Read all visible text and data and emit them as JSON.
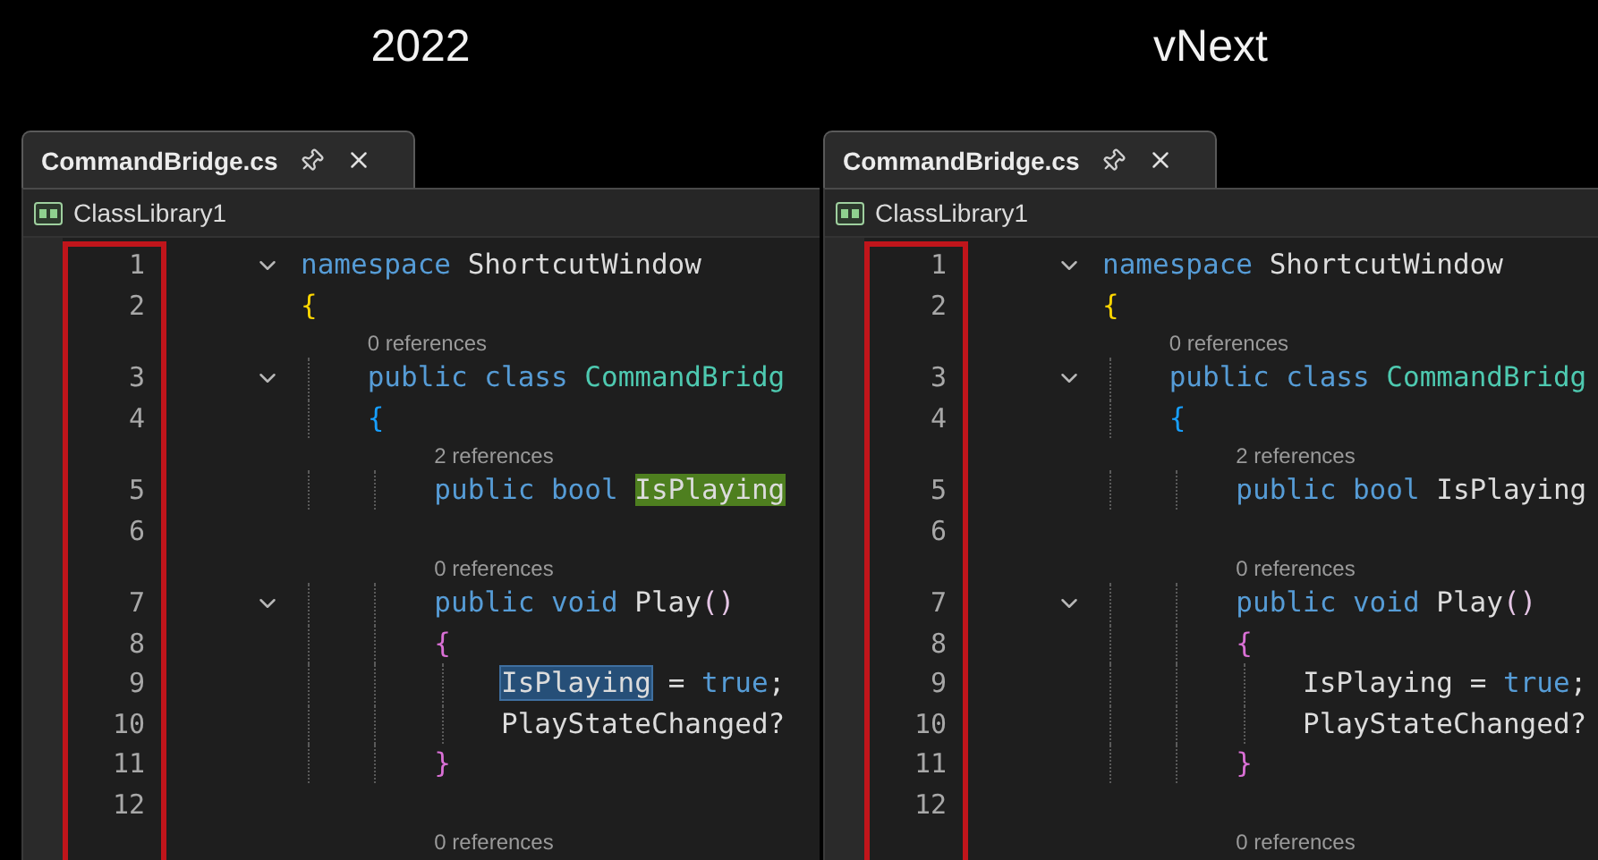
{
  "panels": [
    {
      "heading": "2022",
      "tab": {
        "title": "CommandBridge.cs"
      },
      "project": "ClassLibrary1",
      "rows": [
        {
          "kind": "code",
          "number": "1",
          "expanded": true,
          "tokens": [
            {
              "text": "namespace ",
              "kind": "keyword"
            },
            {
              "text": "ShortcutWindow",
              "kind": "plain"
            }
          ]
        },
        {
          "kind": "code",
          "number": "2",
          "tokens": [
            {
              "text": "{",
              "kind": "brace-gold"
            }
          ]
        },
        {
          "kind": "lens",
          "text": "0 references"
        },
        {
          "kind": "code",
          "number": "3",
          "expanded": true,
          "tokens": [
            {
              "text": "    public class ",
              "kind": "keyword"
            },
            {
              "text": "CommandBridg",
              "kind": "type"
            }
          ]
        },
        {
          "kind": "code",
          "number": "4",
          "tokens": [
            {
              "text": "    {",
              "kind": "brace-blue"
            }
          ]
        },
        {
          "kind": "lens",
          "text": "2 references"
        },
        {
          "kind": "code",
          "number": "5",
          "tokens": [
            {
              "text": "        public bool ",
              "kind": "keyword"
            },
            {
              "text": "IsPlaying",
              "kind": "plain",
              "highlighted": true
            }
          ]
        },
        {
          "kind": "code",
          "number": "6"
        },
        {
          "kind": "lens",
          "text": "0 references"
        },
        {
          "kind": "code",
          "number": "7",
          "expanded": true,
          "tokens": [
            {
              "text": "        public void ",
              "kind": "keyword"
            },
            {
              "text": "Play",
              "kind": "plain"
            },
            {
              "text": "()",
              "kind": "paren"
            }
          ]
        },
        {
          "kind": "code",
          "number": "8",
          "tokens": [
            {
              "text": "        {",
              "kind": "brace-pink"
            }
          ]
        },
        {
          "kind": "code",
          "number": "9",
          "tokens": [
            {
              "text": "            IsPlaying",
              "kind": "plain",
              "selected": true
            },
            {
              "text": " = ",
              "kind": "plain"
            },
            {
              "text": "true",
              "kind": "keyword"
            },
            {
              "text": ";",
              "kind": "plain"
            }
          ]
        },
        {
          "kind": "code",
          "number": "10",
          "tokens": [
            {
              "text": "            PlayStateChanged?",
              "kind": "plain"
            }
          ]
        },
        {
          "kind": "code",
          "number": "11",
          "tokens": [
            {
              "text": "        }",
              "kind": "brace-pink"
            }
          ]
        },
        {
          "kind": "code",
          "number": "12"
        },
        {
          "kind": "lens",
          "text": "0 references"
        }
      ]
    },
    {
      "heading": "vNext",
      "tab": {
        "title": "CommandBridge.cs"
      },
      "project": "ClassLibrary1",
      "rows": [
        {
          "kind": "code",
          "number": "1",
          "expanded": true,
          "tokens": [
            {
              "text": "namespace ",
              "kind": "keyword"
            },
            {
              "text": "ShortcutWindow",
              "kind": "plain"
            }
          ]
        },
        {
          "kind": "code",
          "number": "2",
          "tokens": [
            {
              "text": "{",
              "kind": "brace-gold"
            }
          ]
        },
        {
          "kind": "lens",
          "text": "0 references"
        },
        {
          "kind": "code",
          "number": "3",
          "expanded": true,
          "tokens": [
            {
              "text": "    public class ",
              "kind": "keyword"
            },
            {
              "text": "CommandBridg",
              "kind": "type"
            }
          ]
        },
        {
          "kind": "code",
          "number": "4",
          "tokens": [
            {
              "text": "    {",
              "kind": "brace-blue"
            }
          ]
        },
        {
          "kind": "lens",
          "text": "2 references"
        },
        {
          "kind": "code",
          "number": "5",
          "tokens": [
            {
              "text": "        public bool ",
              "kind": "keyword"
            },
            {
              "text": "IsPlaying",
              "kind": "plain"
            }
          ]
        },
        {
          "kind": "code",
          "number": "6"
        },
        {
          "kind": "lens",
          "text": "0 references"
        },
        {
          "kind": "code",
          "number": "7",
          "expanded": true,
          "tokens": [
            {
              "text": "        public void ",
              "kind": "keyword"
            },
            {
              "text": "Play",
              "kind": "plain"
            },
            {
              "text": "()",
              "kind": "paren"
            }
          ]
        },
        {
          "kind": "code",
          "number": "8",
          "tokens": [
            {
              "text": "        {",
              "kind": "brace-pink"
            }
          ]
        },
        {
          "kind": "code",
          "number": "9",
          "tokens": [
            {
              "text": "            IsPlaying",
              "kind": "plain"
            },
            {
              "text": " = ",
              "kind": "plain"
            },
            {
              "text": "true",
              "kind": "keyword"
            },
            {
              "text": ";",
              "kind": "plain"
            }
          ]
        },
        {
          "kind": "code",
          "number": "10",
          "tokens": [
            {
              "text": "            PlayStateChanged?",
              "kind": "plain"
            }
          ]
        },
        {
          "kind": "code",
          "number": "11",
          "tokens": [
            {
              "text": "        }",
              "kind": "brace-pink"
            }
          ]
        },
        {
          "kind": "code",
          "number": "12"
        },
        {
          "kind": "lens",
          "text": "0 references"
        }
      ]
    }
  ]
}
